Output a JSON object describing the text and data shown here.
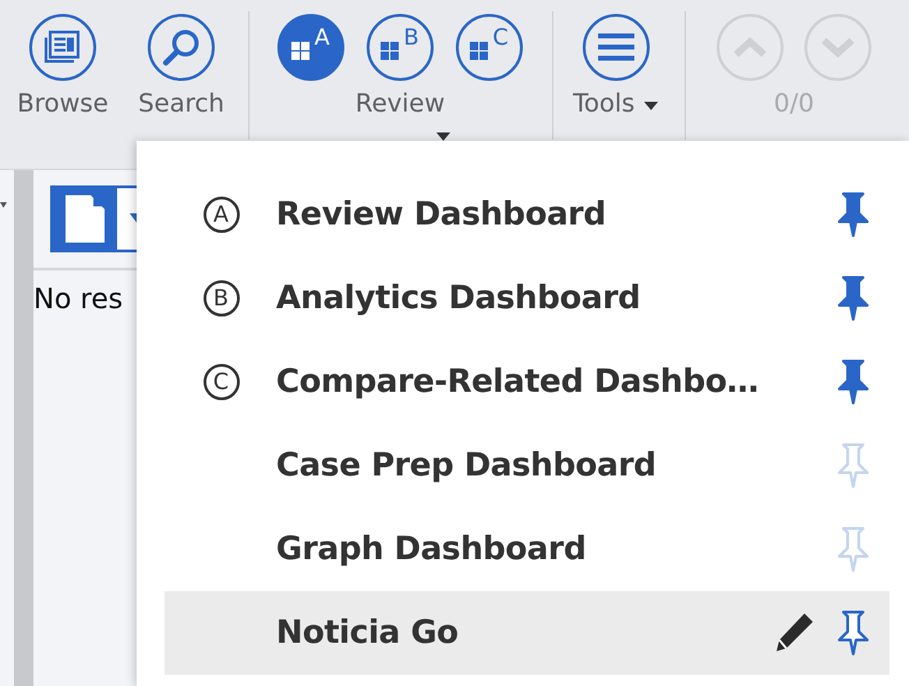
{
  "toolbar": {
    "browse": {
      "label": "Browse"
    },
    "search": {
      "label": "Search"
    },
    "dashboards": {
      "label": "Review",
      "buttons": [
        {
          "letter": "A",
          "selected": true
        },
        {
          "letter": "B",
          "selected": false
        },
        {
          "letter": "C",
          "selected": false
        }
      ]
    },
    "tools": {
      "label": "Tools"
    },
    "navigation": {
      "counter": "0/0",
      "disabled": true
    }
  },
  "results_pane": {
    "message": "No res"
  },
  "dashboard_menu": {
    "items": [
      {
        "badge": "A",
        "label": "Review Dashboard",
        "pinned": true,
        "selected": false
      },
      {
        "badge": "B",
        "label": "Analytics Dashboard",
        "pinned": true,
        "selected": false
      },
      {
        "badge": "C",
        "label": "Compare-Related Dashbo…",
        "pinned": true,
        "selected": false
      },
      {
        "label": "Case Prep Dashboard",
        "pinned": false,
        "selected": false
      },
      {
        "label": "Graph Dashboard",
        "pinned": false,
        "selected": false
      },
      {
        "label": "Noticia Go",
        "pinned": false,
        "selected": true
      }
    ]
  }
}
